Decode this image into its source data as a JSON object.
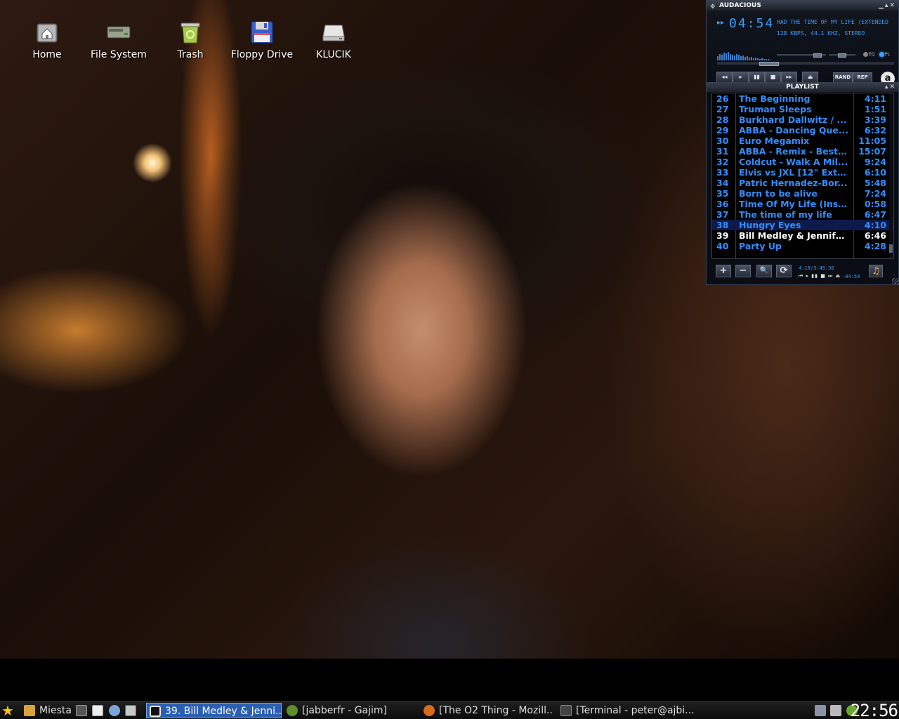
{
  "desktop": {
    "icons": [
      {
        "label": "Home",
        "icon": "home-folder-icon"
      },
      {
        "label": "File System",
        "icon": "drive-icon"
      },
      {
        "label": "Trash",
        "icon": "trash-icon"
      },
      {
        "label": "Floppy Drive",
        "icon": "floppy-icon"
      },
      {
        "label": "KLUCIK",
        "icon": "usb-drive-icon"
      }
    ]
  },
  "player": {
    "title": "AUDACIOUS",
    "play_indicator": "▸▸",
    "time": "04:54",
    "song_ticker": "HAD THE TIME OF MY LIFE (EXTENDED",
    "bitrate_info": "128 KBPS, 44.1 KHZ, STEREO",
    "eq_label": "EQ",
    "pl_label": "PL",
    "controls": [
      "◂◂",
      "▸",
      "▮▮",
      "■",
      "▸▸"
    ],
    "eject": "⏏",
    "rand_label": "RAND",
    "rep_label": "REP",
    "logo": "a",
    "accent_color": "#2f8fff"
  },
  "playlist": {
    "title": "PLAYLIST",
    "rows": [
      {
        "num": "26",
        "title": "The Beginning",
        "dur": "4:11"
      },
      {
        "num": "27",
        "title": "Truman Sleeps",
        "dur": "1:51"
      },
      {
        "num": "28",
        "title": "Burkhard Dallwitz / ...",
        "dur": "3:39"
      },
      {
        "num": "29",
        "title": "ABBA - Dancing Que...",
        "dur": "6:32"
      },
      {
        "num": "30",
        "title": "Euro Megamix",
        "dur": "11:05"
      },
      {
        "num": "31",
        "title": "ABBA - Remix - Best ...",
        "dur": "15:07"
      },
      {
        "num": "32",
        "title": "Coldcut - Walk A Mil...",
        "dur": "9:24"
      },
      {
        "num": "33",
        "title": "Elvis vs JXL [12\" Exte...",
        "dur": "6:10"
      },
      {
        "num": "34",
        "title": "Patric Hernadez-Bor...",
        "dur": "5:48"
      },
      {
        "num": "35",
        "title": "Born to be alive",
        "dur": "7:24"
      },
      {
        "num": "36",
        "title": "Time Of My Life (Inst...",
        "dur": "0:58"
      },
      {
        "num": "37",
        "title": "The time of my life",
        "dur": "6:47"
      },
      {
        "num": "38",
        "title": "Hungry Eyes",
        "dur": "4:10",
        "selected": true
      },
      {
        "num": "39",
        "title": "Bill Medley & Jennife...",
        "dur": "6:46",
        "current": true
      },
      {
        "num": "40",
        "title": "Party Up",
        "dur": "4:28"
      }
    ],
    "tools": [
      "+",
      "−",
      "🔍",
      "⟳"
    ],
    "time_summary": "4:10/3:45:36",
    "mini_controls": "⏮ ▸ ▮▮ ■ ⏭ ⏏",
    "remaining": "-04:54"
  },
  "taskbar": {
    "start_icon": "star-icon",
    "places_label": "Miesta",
    "tasks": [
      {
        "label": "39. Bill Medley & Jenni...",
        "icon": "audacious-icon",
        "active": true
      },
      {
        "label": "[jabberfr - Gajim]",
        "icon": "gajim-icon",
        "active": false
      },
      {
        "label": "[The O2 Thing - Mozill...",
        "icon": "firefox-icon",
        "active": false
      },
      {
        "label": "[Terminal - peter@ajbi...",
        "icon": "terminal-icon",
        "active": false
      }
    ],
    "clock": "22:56"
  }
}
